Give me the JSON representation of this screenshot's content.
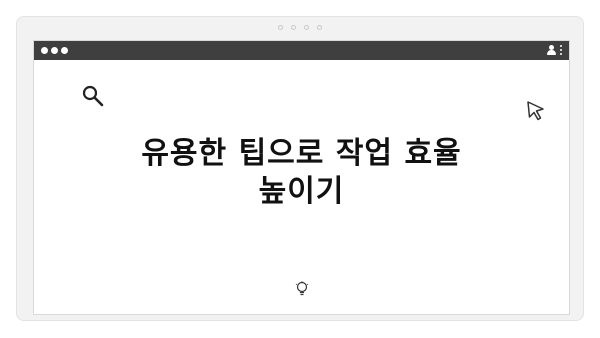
{
  "headline": {
    "line1": "유용한 팁으로 작업 효율",
    "line2": "높이기"
  },
  "icons": {
    "search": "search-icon",
    "cursor": "cursor-icon",
    "bulb": "lightbulb-icon",
    "user": "user-icon",
    "menu": "kebab-menu-icon"
  },
  "colors": {
    "title_bar": "#3f3f3f",
    "frame": "#f2f2f2",
    "text": "#111111"
  }
}
